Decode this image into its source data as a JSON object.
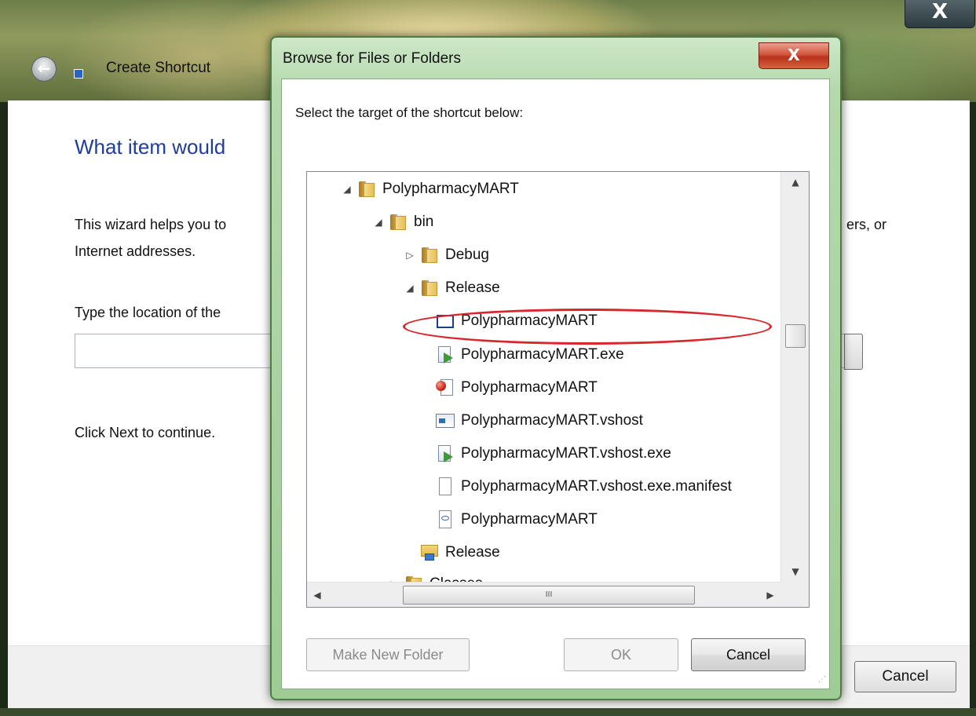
{
  "wizard": {
    "close_label": "X",
    "back_label": "←",
    "title": "Create Shortcut",
    "heading": "What item would",
    "intro_line1_left": "This wizard helps you to",
    "intro_line1_right": "ers, or",
    "intro_line2": "Internet addresses.",
    "location_label": "Type the location of the",
    "location_value": "",
    "next_prompt": "Click Next to continue.",
    "cancel_label": "Cancel"
  },
  "dialog": {
    "title": "Browse for Files or Folders",
    "close_label": "X",
    "prompt": "Select the target of the shortcut below:",
    "tree": {
      "items": [
        {
          "label": "PolypharmacyMART",
          "icon": "folder-icon",
          "expander": "◢"
        },
        {
          "label": "bin",
          "icon": "folder-icon",
          "expander": "◢"
        },
        {
          "label": "Debug",
          "icon": "folder-icon",
          "expander": "▷"
        },
        {
          "label": "Release",
          "icon": "folder-icon",
          "expander": "◢"
        },
        {
          "label": "PolypharmacyMART",
          "icon": "application-window-icon",
          "selected_highlight": true
        },
        {
          "label": "PolypharmacyMART.exe",
          "icon": "executable-icon"
        },
        {
          "label": "PolypharmacyMART",
          "icon": "program-debug-database-icon"
        },
        {
          "label": "PolypharmacyMART.vshost",
          "icon": "vshost-application-icon"
        },
        {
          "label": "PolypharmacyMART.vshost.exe",
          "icon": "executable-icon"
        },
        {
          "label": "PolypharmacyMART.vshost.exe.manifest",
          "icon": "document-icon"
        },
        {
          "label": "PolypharmacyMART",
          "icon": "config-file-icon"
        },
        {
          "label": "Release",
          "icon": "network-folder-icon"
        },
        {
          "label": "Classes",
          "icon": "folder-icon",
          "expander": "▷"
        }
      ],
      "scroll_up": "▲",
      "scroll_down": "▼",
      "scroll_left": "◀",
      "scroll_right": "▶",
      "hthumb_grip": "III"
    },
    "make_new_folder_label": "Make New Folder",
    "ok_label": "OK",
    "cancel_label": "Cancel"
  },
  "colors": {
    "heading_blue": "#1f3d99",
    "dialog_frame_green": "#9fcb95",
    "close_red": "#c23a20",
    "annotation_red": "#d8262b"
  }
}
